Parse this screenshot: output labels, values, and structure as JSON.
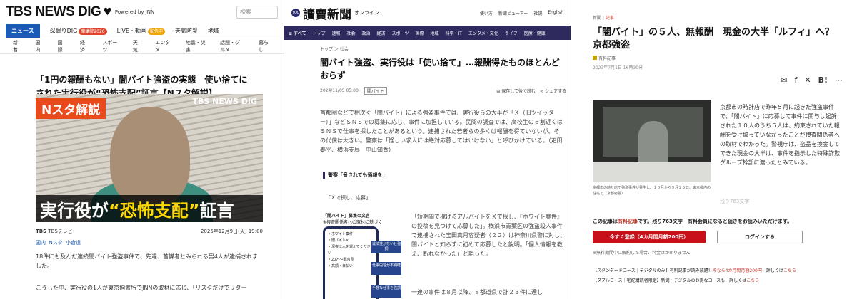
{
  "tbs": {
    "logo": "TBS NEWS DIG",
    "powered": "Powered by JNN",
    "search_placeholder": "検索",
    "nav1": [
      {
        "label": "ニュース",
        "active": true
      },
      {
        "label": "深掘りDIG",
        "badge": "衆議院2026"
      },
      {
        "label": "LIVE・動画",
        "badge": "配信中"
      },
      {
        "label": "天気防災"
      },
      {
        "label": "地域"
      }
    ],
    "nav2": [
      "新着",
      "国内",
      "国際",
      "経済",
      "スポーツ",
      "天気",
      "エンタメ",
      "地震・災害",
      "話題・グルメ",
      "暮らし"
    ],
    "title": "「1円の報酬もない」闇バイト強盗の実態　使い捨てにされた実行役が“恐怖支配”証言【Nスタ解説】",
    "image": {
      "badge": "Nスタ解説",
      "brand": "TBS NEWS DIG",
      "caption_pre": "実行役が",
      "caption_hl": "“恐怖支配”",
      "caption_post": "証言"
    },
    "source_tag": "TBS",
    "source": "TBSテレビ",
    "date": "2025年12月9日(火) 19:00",
    "tags": [
      "国内",
      "Nスタ",
      "小倉道"
    ],
    "body1": "18件にも及んだ連続闇バイト強盗事件で、先週、首謀者とみられる男4人が逮捕されました。",
    "body2": "こうした中、実行役の1人が東京拘置所でJNNの取材に応じ、「リスクだけでリター"
  },
  "yomiuri": {
    "logo_mark": "YOL",
    "logo": "讀賣新聞",
    "online": "オンライン",
    "links": [
      "使い方",
      "新聞ビューアー",
      "社説",
      "English"
    ],
    "nav": [
      "≡ すべて",
      "トップ",
      "速報",
      "社会",
      "政治",
      "経済",
      "スポーツ",
      "国際",
      "地域",
      "科学・IT",
      "エンタメ・文化",
      "ライフ",
      "医療・健康"
    ],
    "crumb": "トップ ＞ 社会",
    "title": "闇バイト強盗、実行役は「使い捨て」…報酬得たものほとんどおらず",
    "date": "2024/11/05 05:00",
    "tag": "闇バイト",
    "save": "保存して後で読む",
    "share": "シェアする",
    "body": "首都圏などで相次ぐ「闇バイト」による強盗事件では、実行役らの大半が「Ｘ（旧ツイッター）」などＳＮＳでの募集に応じ、事件に加担している。民間の調査では、高校生の５割近くはＳＮＳで仕事を探したことがあるという。逮捕された若者らの多くは報酬を得ていないが、その代償は大きい。警察は「怪しい求人には絶対応募してはいけない」と呼びかけている。（疋田泰平、横浜支局　中山知香）",
    "section": "警察「脅されても通報を」",
    "subsection": "「Ｘで探し、応募」",
    "fig_title": "「闇バイト」募集の文言",
    "fig_sub": "※捜査関係者への取材に基づく",
    "fig_items": [
      "・ホワイト案件",
      "・闇バイト×",
      "・深夜に人を運んでください",
      "・20万〜即内見",
      "・高額・日払い"
    ],
    "fig_bubbles": [
      "違法性がないと強調",
      "仕事内容が不明確",
      "手軽な仕事を強調"
    ],
    "right_body": "「短期間で稼げるアルバイトをＸで探し、『ホワイト案件』の投稿を見つけて応募した」。横浜市青葉区の強盗殺人事件で逮捕された宝田真月容疑者（２２）は神奈川県警に対し、闇バイトと知らずに初めて応募したと説明。「個人情報を教え、断れなかった」と語った。",
    "bottom": "一連の事件は８月以降、８都道県で計２３件に達し"
  },
  "kyoto": {
    "crumb_pre": "新聞",
    "crumb": "記事",
    "title": "「闇バイト」の５人、無報酬　現金の大半「ルフィ」へ？京都強盗",
    "badge": "有料記事",
    "date": "2023年7月1日 16時30分",
    "icons": [
      "mail-icon",
      "facebook-icon",
      "x-icon",
      "hatena-icon",
      "more-icon"
    ],
    "photo_caption": "京都市の時計店で強盗事件が発生し、１０月から９月２５日、東京都内の住宅で（京都府警）",
    "body": "京都市の時計店で昨年５月に起きた強盗事件で、「闇バイト」に応募して事件に関与し起訴された１０人のうち５人は、約束されていた報酬を受け取っていなかったことが捜査関係者への取材でわかった。警視庁は、盗品を換金してできた現金の大半は、事件を指示した特殊詐欺グループ幹部に渡ったとみている。",
    "fade": "残り763文字",
    "pay_pre": "この記事は",
    "pay_red": "有料記事",
    "pay_post": "です。残り763文字　有料会員になると続きをお読みいただけます。",
    "btn_register": "今すぐ登録（4カ月間月額200円）",
    "btn_login": "ログインする",
    "note": "※無料期間中に解約した場合、料金はかかりません",
    "course1_pre": "【スタンダードコース｜デジタルのみ】有料記事が読み放題！",
    "course1_red": "今なら4カ月間月額200円",
    "course1_post": "！詳しくは",
    "course1_link": "こちら",
    "course2_pre": "【ダブルコース｜宅配購読者限定】新聞・デジタルのお得なコースも！詳しくは",
    "course2_link": "こちら"
  }
}
